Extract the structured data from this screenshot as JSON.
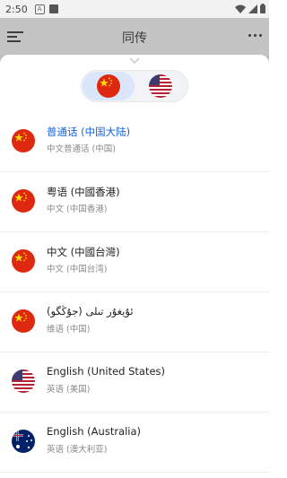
{
  "status_bar": {
    "time": "2:50",
    "notif_letter": "A",
    "icons": [
      "wifi-icon",
      "cell-signal-icon",
      "battery-icon"
    ]
  },
  "app_bar": {
    "title": "同传",
    "icons": [
      "menu-icon",
      "more-vert-icon"
    ]
  },
  "sheet": {
    "handle_icon": "chevron-down-icon",
    "switch": {
      "selected": "source",
      "source_flag": "china-flag-icon",
      "target_flag": "us-flag-icon"
    },
    "languages": [
      {
        "name": "普通话 (中国大陆)",
        "sub": "中文普通话 (中国)",
        "flag": "cn",
        "selected": true
      },
      {
        "name": "粤语 (中國香港)",
        "sub": "中文 (中国香港)",
        "flag": "cn",
        "selected": false
      },
      {
        "name": "中文 (中國台灣)",
        "sub": "中文 (中国台湾)",
        "flag": "cn",
        "selected": false
      },
      {
        "name": "ئۇيغۇر تىلى (جۇڭگو)",
        "sub": "维语 (中国)",
        "flag": "cn",
        "selected": false
      },
      {
        "name": "English (United States)",
        "sub": "英语 (美国)",
        "flag": "us",
        "selected": false
      },
      {
        "name": "English (Australia)",
        "sub": "英语 (澳大利亚)",
        "flag": "au",
        "selected": false
      }
    ]
  },
  "colors": {
    "accent": "#1a62d6",
    "selected_segment": "#d9e6fb",
    "china_red": "#de2910",
    "china_star": "#ffde00",
    "us_blue": "#3c3b6e",
    "us_red": "#b22234",
    "au_blue": "#012169"
  }
}
